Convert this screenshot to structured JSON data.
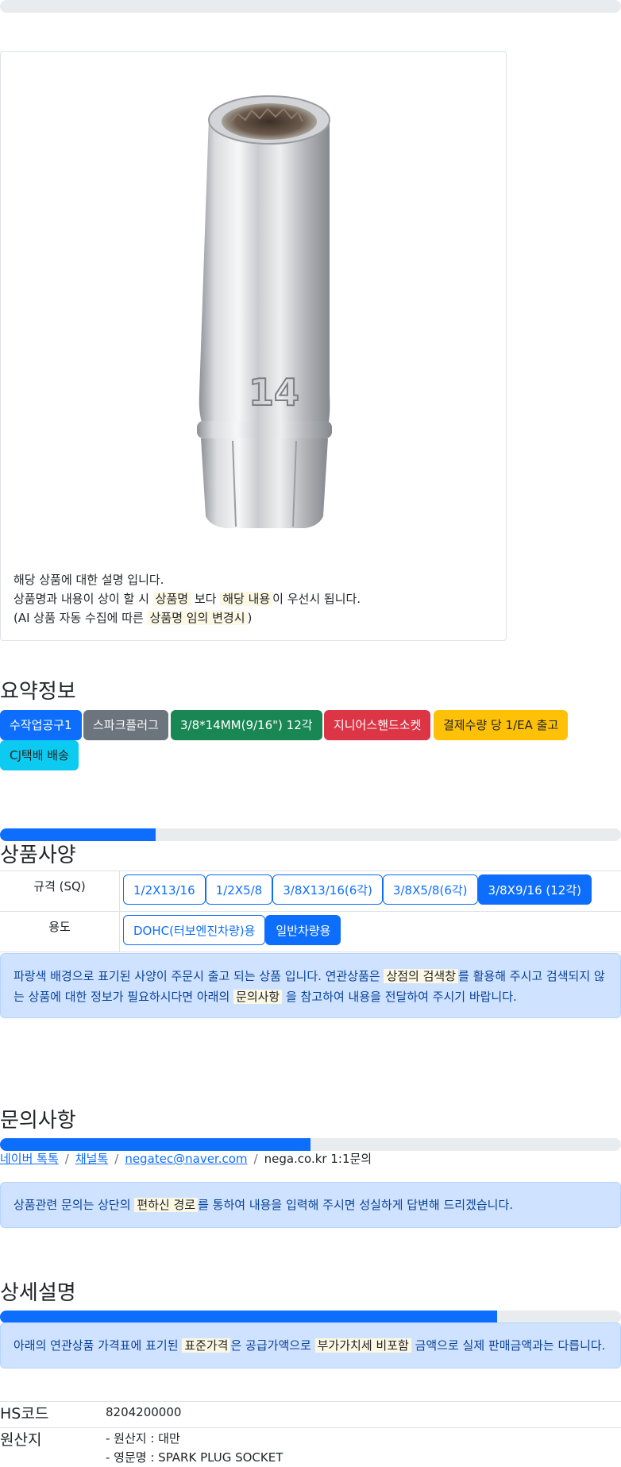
{
  "product": {
    "image_label": "socket-14mm-image",
    "engraving": "14",
    "desc_line1": "해당 상품에 대한 설명 입니다.",
    "desc_line2_prefix": "상품명과 내용이 상이 할 시 ",
    "desc_line2_mark1": "상품명",
    "desc_line2_mid": " 보다 ",
    "desc_line2_mark2": "해당 내용",
    "desc_line2_suffix": "이 우선시 됩니다.",
    "desc_line3_prefix": "(AI 상품 자동 수집에 따른 ",
    "desc_line3_mark": "상품명 임의 변경시",
    "desc_line3_suffix": ")"
  },
  "summary": {
    "title": "요약정보",
    "badges": [
      {
        "label": "수작업공구1",
        "color": "#0d6efd"
      },
      {
        "label": "스파크플러그",
        "color": "#6c757d"
      },
      {
        "label": "3/8*14MM(9/16\") 12각",
        "color": "#198754"
      },
      {
        "label": "지니어스핸드소켓",
        "color": "#dc3545"
      },
      {
        "label": "결제수량 당 1/EA 출고",
        "color": "#ffc107"
      },
      {
        "label": "CJ택배 배송",
        "color": "#0dcaf0"
      }
    ]
  },
  "spec": {
    "title": "상품사양",
    "progress": 0.25,
    "rows": [
      {
        "label": "규격 (SQ)",
        "options": [
          "1/2X13/16",
          "1/2X5/8",
          "3/8X13/16(6각)",
          "3/8X5/8(6각)",
          "3/8X9/16 (12각)"
        ],
        "selected": 4
      },
      {
        "label": "용도",
        "options": [
          "DOHC(터보엔진차량)용",
          "일반차량용"
        ],
        "selected": 1
      }
    ],
    "notice_p1": "파랑색 배경으로 표기된 사양이 주문시 출고 되는 상품 입니다. 연관상품은 ",
    "notice_m1": "상점의 검색창",
    "notice_p2": "를 활용해 주시고 검색되지 않",
    "notice_p3": "는 상품에 대한 정보가 필요하시다면 아래의 ",
    "notice_m2": "문의사항",
    "notice_p4": " 을 참고하여 내용을 전달하여 주시기 바랍니다."
  },
  "inquiry": {
    "title": "문의사항",
    "progress": 0.5,
    "links": [
      "네이버 톡톡",
      "채널톡",
      "negatec@naver.com"
    ],
    "plain": "nega.co.kr 1:1문의",
    "notice_p1": "상품관련 문의는 상단의 ",
    "notice_m": "편하신 경로",
    "notice_p2": "를 통하여 내용을 입력해 주시면 성실하게 답변해 드리겠습니다."
  },
  "detail": {
    "title": "상세설명",
    "progress": 0.8,
    "notice_p1": "아래의 연관상품 가격표에 표기된 ",
    "notice_m1": "표준가격",
    "notice_p2": "은 공급가액으로 ",
    "notice_m2": "부가가치세 비포함",
    "notice_p3": " 금액으로 실제 판매금액과는 다릅니다.",
    "hs_label": "HS코드",
    "hs_value": "8204200000",
    "origin_label": "원산지",
    "origin_line1": "- 원산지 : 대만",
    "origin_line2": "- 영문명 : SPARK PLUG SOCKET"
  }
}
